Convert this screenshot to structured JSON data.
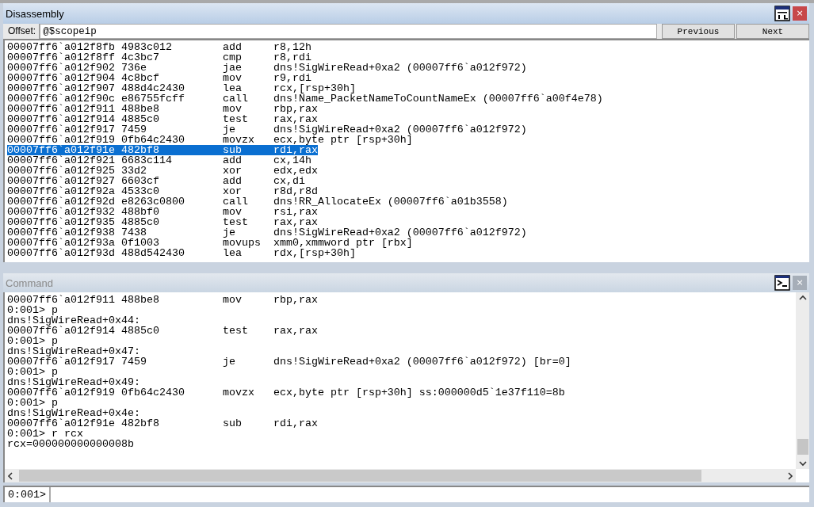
{
  "disassembly": {
    "title": "Disassembly",
    "close": "×",
    "offset_label": "Offset:",
    "offset_value": "@$scopeip",
    "buttons": [
      "Previous",
      "Next"
    ],
    "rows": [
      {
        "address": "00007ff6`a012f8fb",
        "bytes": "4983c012",
        "mnemonic": "add",
        "operands": "r8,12h",
        "selected": false
      },
      {
        "address": "00007ff6`a012f8ff",
        "bytes": "4c3bc7",
        "mnemonic": "cmp",
        "operands": "r8,rdi",
        "selected": false
      },
      {
        "address": "00007ff6`a012f902",
        "bytes": "736e",
        "mnemonic": "jae",
        "operands": "dns!SigWireRead+0xa2 (00007ff6`a012f972)",
        "selected": false
      },
      {
        "address": "00007ff6`a012f904",
        "bytes": "4c8bcf",
        "mnemonic": "mov",
        "operands": "r9,rdi",
        "selected": false
      },
      {
        "address": "00007ff6`a012f907",
        "bytes": "488d4c2430",
        "mnemonic": "lea",
        "operands": "rcx,[rsp+30h]",
        "selected": false
      },
      {
        "address": "00007ff6`a012f90c",
        "bytes": "e86755fcff",
        "mnemonic": "call",
        "operands": "dns!Name_PacketNameToCountNameEx (00007ff6`a00f4e78)",
        "selected": false
      },
      {
        "address": "00007ff6`a012f911",
        "bytes": "488be8",
        "mnemonic": "mov",
        "operands": "rbp,rax",
        "selected": false
      },
      {
        "address": "00007ff6`a012f914",
        "bytes": "4885c0",
        "mnemonic": "test",
        "operands": "rax,rax",
        "selected": false
      },
      {
        "address": "00007ff6`a012f917",
        "bytes": "7459",
        "mnemonic": "je",
        "operands": "dns!SigWireRead+0xa2 (00007ff6`a012f972)",
        "selected": false
      },
      {
        "address": "00007ff6`a012f919",
        "bytes": "0fb64c2430",
        "mnemonic": "movzx",
        "operands": "ecx,byte ptr [rsp+30h]",
        "selected": false
      },
      {
        "address": "00007ff6`a012f91e",
        "bytes": "482bf8",
        "mnemonic": "sub",
        "operands": "rdi,rax",
        "selected": true
      },
      {
        "address": "00007ff6`a012f921",
        "bytes": "6683c114",
        "mnemonic": "add",
        "operands": "cx,14h",
        "selected": false
      },
      {
        "address": "00007ff6`a012f925",
        "bytes": "33d2",
        "mnemonic": "xor",
        "operands": "edx,edx",
        "selected": false
      },
      {
        "address": "00007ff6`a012f927",
        "bytes": "6603cf",
        "mnemonic": "add",
        "operands": "cx,di",
        "selected": false
      },
      {
        "address": "00007ff6`a012f92a",
        "bytes": "4533c0",
        "mnemonic": "xor",
        "operands": "r8d,r8d",
        "selected": false
      },
      {
        "address": "00007ff6`a012f92d",
        "bytes": "e8263c0800",
        "mnemonic": "call",
        "operands": "dns!RR_AllocateEx (00007ff6`a01b3558)",
        "selected": false
      },
      {
        "address": "00007ff6`a012f932",
        "bytes": "488bf0",
        "mnemonic": "mov",
        "operands": "rsi,rax",
        "selected": false
      },
      {
        "address": "00007ff6`a012f935",
        "bytes": "4885c0",
        "mnemonic": "test",
        "operands": "rax,rax",
        "selected": false
      },
      {
        "address": "00007ff6`a012f938",
        "bytes": "7438",
        "mnemonic": "je",
        "operands": "dns!SigWireRead+0xa2 (00007ff6`a012f972)",
        "selected": false
      },
      {
        "address": "00007ff6`a012f93a",
        "bytes": "0f1003",
        "mnemonic": "movups",
        "operands": "xmm0,xmmword ptr [rbx]",
        "selected": false
      },
      {
        "address": "00007ff6`a012f93d",
        "bytes": "488d542430",
        "mnemonic": "lea",
        "operands": "rdx,[rsp+30h]",
        "selected": false
      }
    ]
  },
  "command": {
    "title": "Command",
    "close": "×",
    "lines": [
      {
        "kind": "asm",
        "address": "00007ff6`a012f911",
        "bytes": "488be8",
        "mnemonic": "mov",
        "operands": "rbp,rax"
      },
      {
        "kind": "text",
        "text": "0:001> p"
      },
      {
        "kind": "text",
        "text": "dns!SigWireRead+0x44:"
      },
      {
        "kind": "asm",
        "address": "00007ff6`a012f914",
        "bytes": "4885c0",
        "mnemonic": "test",
        "operands": "rax,rax"
      },
      {
        "kind": "text",
        "text": "0:001> p"
      },
      {
        "kind": "text",
        "text": "dns!SigWireRead+0x47:"
      },
      {
        "kind": "asm",
        "address": "00007ff6`a012f917",
        "bytes": "7459",
        "mnemonic": "je",
        "operands": "dns!SigWireRead+0xa2 (00007ff6`a012f972) [br=0]"
      },
      {
        "kind": "text",
        "text": "0:001> p"
      },
      {
        "kind": "text",
        "text": "dns!SigWireRead+0x49:"
      },
      {
        "kind": "asm",
        "address": "00007ff6`a012f919",
        "bytes": "0fb64c2430",
        "mnemonic": "movzx",
        "operands": "ecx,byte ptr [rsp+30h] ss:000000d5`1e37f110=8b"
      },
      {
        "kind": "text",
        "text": "0:001> p"
      },
      {
        "kind": "text",
        "text": "dns!SigWireRead+0x4e:"
      },
      {
        "kind": "asm",
        "address": "00007ff6`a012f91e",
        "bytes": "482bf8",
        "mnemonic": "sub",
        "operands": "rdi,rax"
      },
      {
        "kind": "text",
        "text": "0:001> r rcx"
      },
      {
        "kind": "text",
        "text": "rcx=000000000000008b"
      }
    ],
    "prompt": "0:001>"
  }
}
